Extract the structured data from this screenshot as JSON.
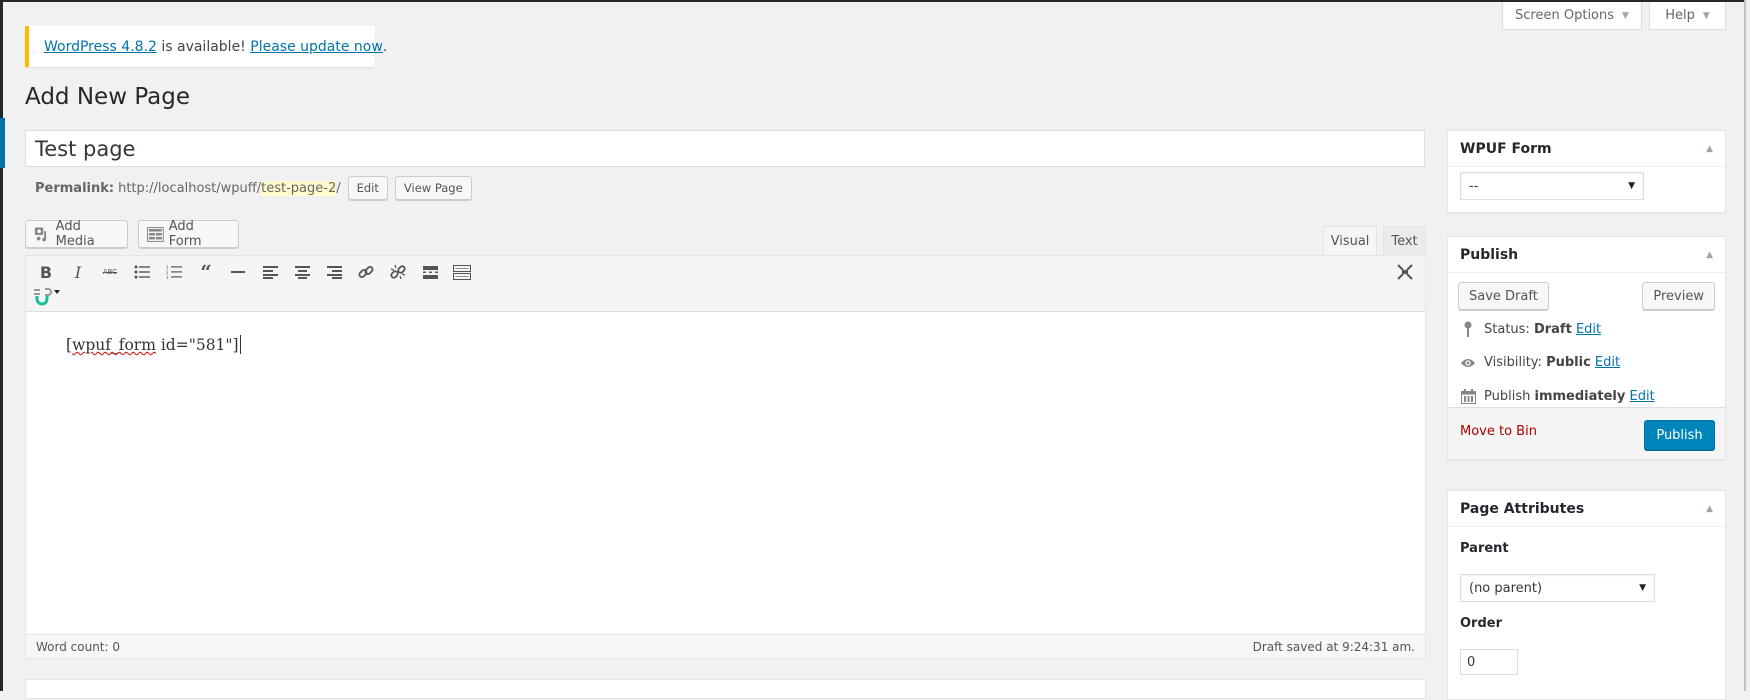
{
  "screen_meta": {
    "screen_options_label": "Screen Options",
    "help_label": "Help"
  },
  "notice": {
    "version_link": "WordPress 4.8.2",
    "middle_text": " is available! ",
    "update_link": "Please update now",
    "end": ".",
    "accent_color": "#ffb900"
  },
  "page_title": "Add New Page",
  "post_title": "Test page",
  "permalink": {
    "label": "Permalink:",
    "base_url": "http://localhost/wpuff/",
    "slug": "test-page-2",
    "trailing": "/",
    "edit_label": "Edit",
    "view_label": "View Page"
  },
  "media_buttons": {
    "add_media": "Add Media",
    "add_form": "Add Form"
  },
  "editor": {
    "tabs": [
      {
        "label": "Visual",
        "active": true
      },
      {
        "label": "Text",
        "active": false
      }
    ],
    "toolbar": [
      {
        "name": "bold",
        "icon": "B"
      },
      {
        "name": "italic",
        "icon": "I"
      },
      {
        "name": "strikethrough",
        "icon": "ABC"
      },
      {
        "name": "bulleted-list",
        "icon": "≔"
      },
      {
        "name": "numbered-list",
        "icon": "≔"
      },
      {
        "name": "blockquote",
        "icon": "❝"
      },
      {
        "name": "horizontal-line",
        "icon": "—"
      },
      {
        "name": "align-left",
        "icon": "≡"
      },
      {
        "name": "align-center",
        "icon": "≡"
      },
      {
        "name": "align-right",
        "icon": "≡"
      },
      {
        "name": "insert-link",
        "icon": "🔗"
      },
      {
        "name": "remove-link",
        "icon": "⛓"
      },
      {
        "name": "read-more",
        "icon": "▬"
      },
      {
        "name": "toolbar-toggle",
        "icon": "⌨"
      }
    ],
    "content_prefix": "[",
    "content_spell": "wpuf_form",
    "content_rest": " id=\"581\"]",
    "word_count": "Word count: 0",
    "draft_saved": "Draft saved at 9:24:31 am."
  },
  "sidebar": {
    "wpuf_form": {
      "title": "WPUF Form",
      "select_value": "--"
    },
    "publish": {
      "title": "Publish",
      "save_draft": "Save Draft",
      "preview": "Preview",
      "status_label": "Status: ",
      "status_value": "Draft",
      "visibility_label": "Visibility: ",
      "visibility_value": "Public",
      "publish_label": "Publish ",
      "publish_value": "immediately",
      "edit_label": "Edit",
      "move_to_bin": "Move to Bin",
      "publish_button": "Publish",
      "primary_color": "#0085ba"
    },
    "page_attributes": {
      "title": "Page Attributes",
      "parent_label": "Parent",
      "parent_value": "(no parent)",
      "order_label": "Order",
      "order_value": "0"
    }
  }
}
